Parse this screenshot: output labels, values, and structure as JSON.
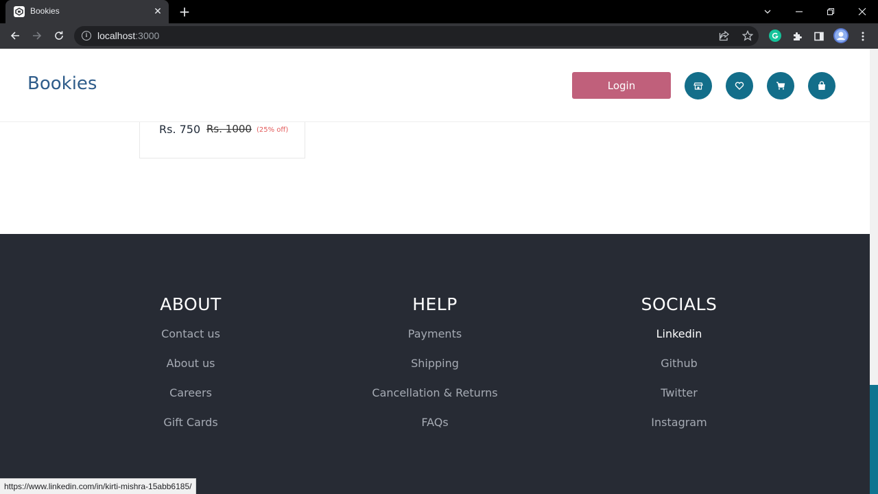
{
  "browser": {
    "tab_title": "Bookies",
    "url_host": "localhost",
    "url_port": ":3000",
    "status_url": "https://www.linkedin.com/in/kirti-mishra-15abb6185/"
  },
  "header": {
    "brand": "Bookies",
    "login_label": "Login",
    "icons": [
      "store-icon",
      "heart-icon",
      "cart-icon",
      "bag-icon"
    ]
  },
  "product_card": {
    "price": "Rs. 750",
    "old_price": "Rs. 1000",
    "discount": "(25% off)"
  },
  "footer": {
    "about": {
      "heading": "ABOUT",
      "links": [
        "Contact us",
        "About us",
        "Careers",
        "Gift Cards"
      ]
    },
    "help": {
      "heading": "HELP",
      "links": [
        "Payments",
        "Shipping",
        "Cancellation & Returns",
        "FAQs"
      ]
    },
    "socials": {
      "heading": "SOCIALS",
      "links": [
        "Linkedin",
        "Github",
        "Twitter",
        "Instagram"
      ]
    }
  },
  "colors": {
    "brand": "#2e5c8a",
    "login_button": "#c0607b",
    "icon_circle": "#136e8a",
    "footer_bg": "#272b34",
    "discount": "#e25858"
  }
}
